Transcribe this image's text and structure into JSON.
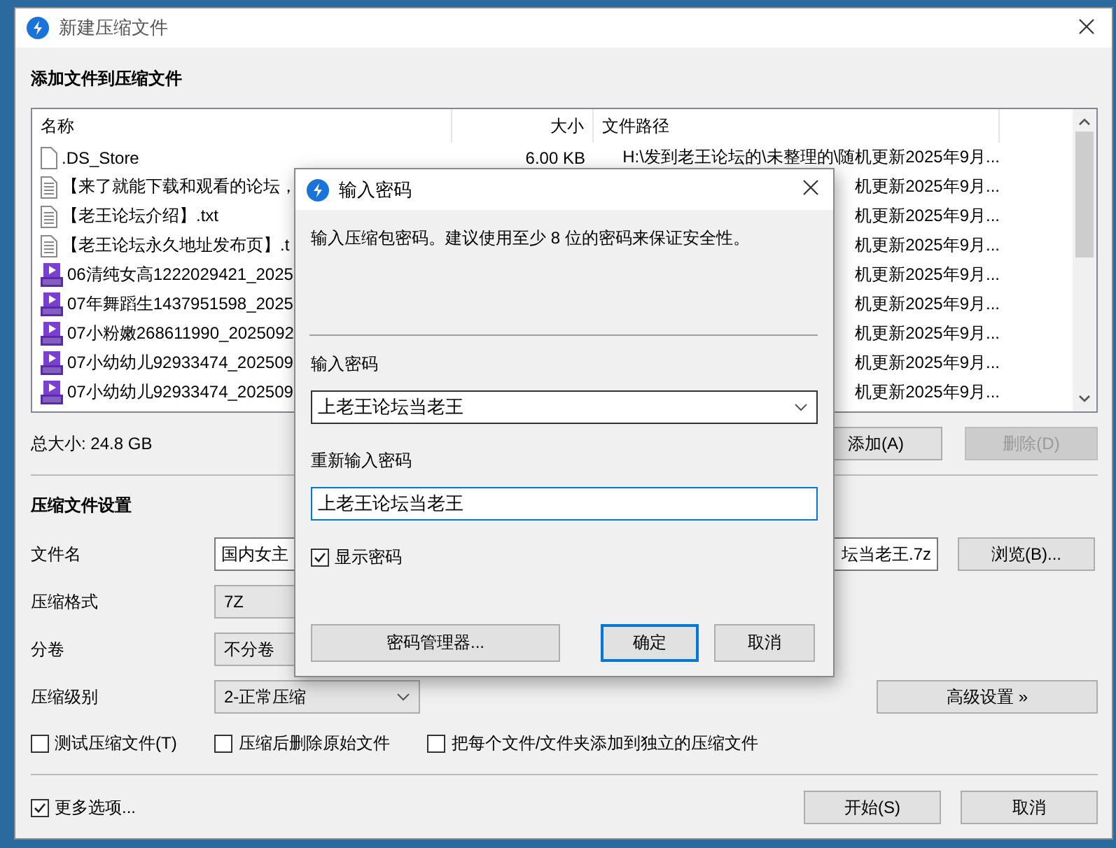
{
  "window": {
    "title": "新建压缩文件"
  },
  "files_heading": "添加文件到压缩文件",
  "file_list": {
    "columns": [
      "名称",
      "大小",
      "文件路径"
    ],
    "rows": [
      {
        "kind": "file",
        "name": ".DS_Store",
        "size": "6.00 KB",
        "path": "H:\\发到老王论坛的\\未整理的\\随机更新2025年9月..."
      },
      {
        "kind": "text",
        "name": "【来了就能下载和观看的论坛，",
        "path": "机更新2025年9月..."
      },
      {
        "kind": "text",
        "name": "【老王论坛介绍】.txt",
        "path": "机更新2025年9月..."
      },
      {
        "kind": "text",
        "name": "【老王论坛永久地址发布页】.t",
        "path": "机更新2025年9月..."
      },
      {
        "kind": "video",
        "name": "06清纯女高1222029421_2025",
        "path": "机更新2025年9月..."
      },
      {
        "kind": "video",
        "name": "07年舞蹈生1437951598_2025",
        "path": "机更新2025年9月..."
      },
      {
        "kind": "video",
        "name": "07小粉嫩268611990_2025092",
        "path": "机更新2025年9月..."
      },
      {
        "kind": "video",
        "name": "07小幼幼儿92933474_202509",
        "path": "机更新2025年9月..."
      },
      {
        "kind": "video",
        "name": "07小幼幼儿92933474_202509",
        "path": "机更新2025年9月..."
      }
    ]
  },
  "total_size": "总大小: 24.8 GB",
  "list_buttons": [
    {
      "label": "添加(A)",
      "disabled": false
    },
    {
      "label": "删除(D)",
      "disabled": true
    }
  ],
  "settings_heading": "压缩文件设置",
  "settings": [
    {
      "kind": "text",
      "label": "文件名",
      "value_start": "国内女主",
      "value_end": "坛当老王.7z",
      "button": "浏览(B)..."
    },
    {
      "kind": "select",
      "label": "压缩格式",
      "value": "7Z"
    },
    {
      "kind": "select",
      "label": "分卷",
      "value": "不分卷"
    },
    {
      "kind": "select",
      "label": "压缩级别",
      "value": "2-正常压缩",
      "button": "高级设置 »"
    }
  ],
  "options": [
    {
      "label": "测试压缩文件(T)",
      "checked": false
    },
    {
      "label": "压缩后删除原始文件",
      "checked": false
    },
    {
      "label": "把每个文件/文件夹添加到独立的压缩文件",
      "checked": false
    }
  ],
  "more_options": {
    "label": "更多选项...",
    "checked": true
  },
  "footer_buttons": [
    "开始(S)",
    "取消"
  ],
  "dialog": {
    "title": "输入密码",
    "message": "输入压缩包密码。建议使用至少 8 位的密码来保证安全性。",
    "password_label": "输入密码",
    "password": "上老王论坛当老王",
    "confirm_label": "重新输入密码",
    "confirm": "上老王论坛当老王",
    "show_password": {
      "label": "显示密码",
      "checked": true
    },
    "buttons": [
      {
        "label": "密码管理器...",
        "default": false
      },
      {
        "label": "确定",
        "default": true
      },
      {
        "label": "取消",
        "default": false
      }
    ]
  }
}
